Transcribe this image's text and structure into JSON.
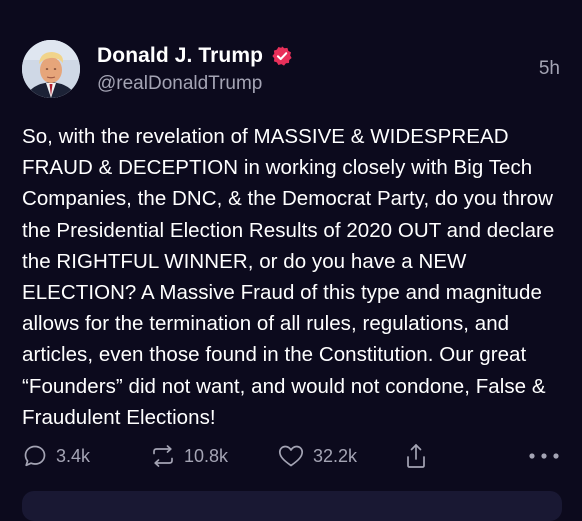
{
  "author": {
    "display_name": "Donald J. Trump",
    "handle": "@realDonaldTrump",
    "verified": true,
    "avatar_icon": "profile-photo"
  },
  "post": {
    "time_ago": "5h",
    "text": "So, with the revelation of MASSIVE & WIDESPREAD FRAUD & DECEPTION in working closely with Big Tech Companies, the DNC, & the Democrat Party, do you throw the Presidential Election Results of 2020 OUT and declare the RIGHTFUL WINNER, or do you have a NEW ELECTION? A Massive Fraud of this type and magnitude allows for the termination of all rules, regulations, and articles, even those found in the Constitution. Our great “Founders” did not want, and would not condone, False & Fraudulent Elections!"
  },
  "actions": {
    "replies": "3.4k",
    "reposts": "10.8k",
    "likes": "32.2k",
    "share_icon": "share-icon",
    "more_icon": "more-icon"
  },
  "colors": {
    "background": "#0c0a1d",
    "muted_text": "#a4a4b4",
    "verified_badge": "#e8305a"
  }
}
